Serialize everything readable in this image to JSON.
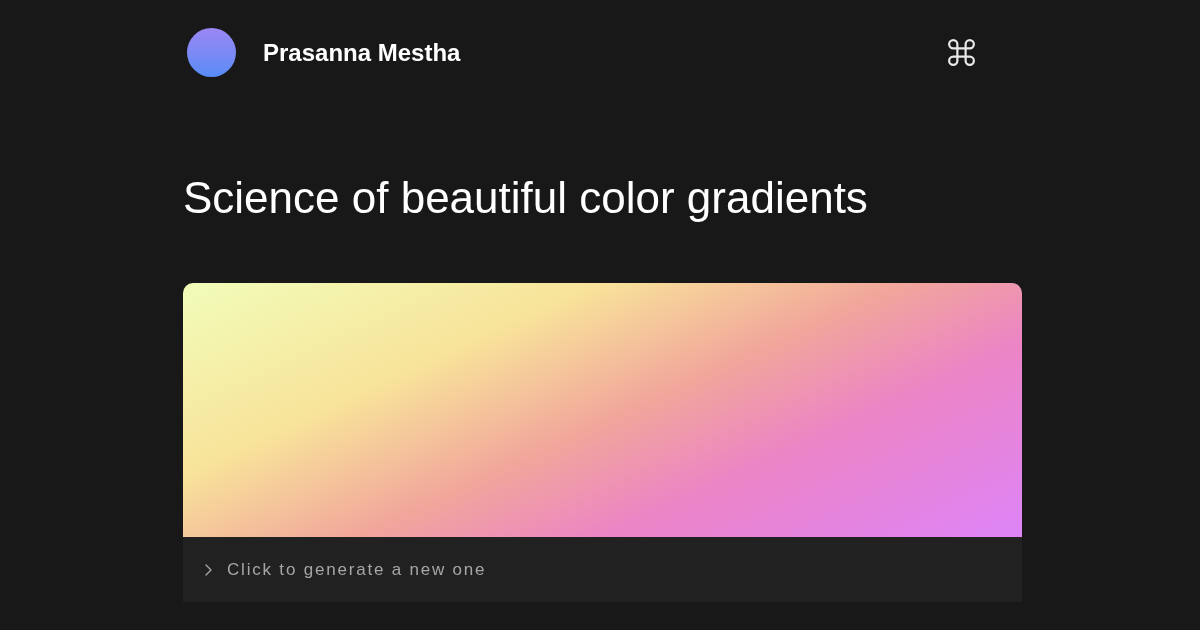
{
  "header": {
    "author": "Prasanna Mestha"
  },
  "title": "Science of beautiful color gradients",
  "generator": {
    "prompt": "Click to generate a new one"
  }
}
